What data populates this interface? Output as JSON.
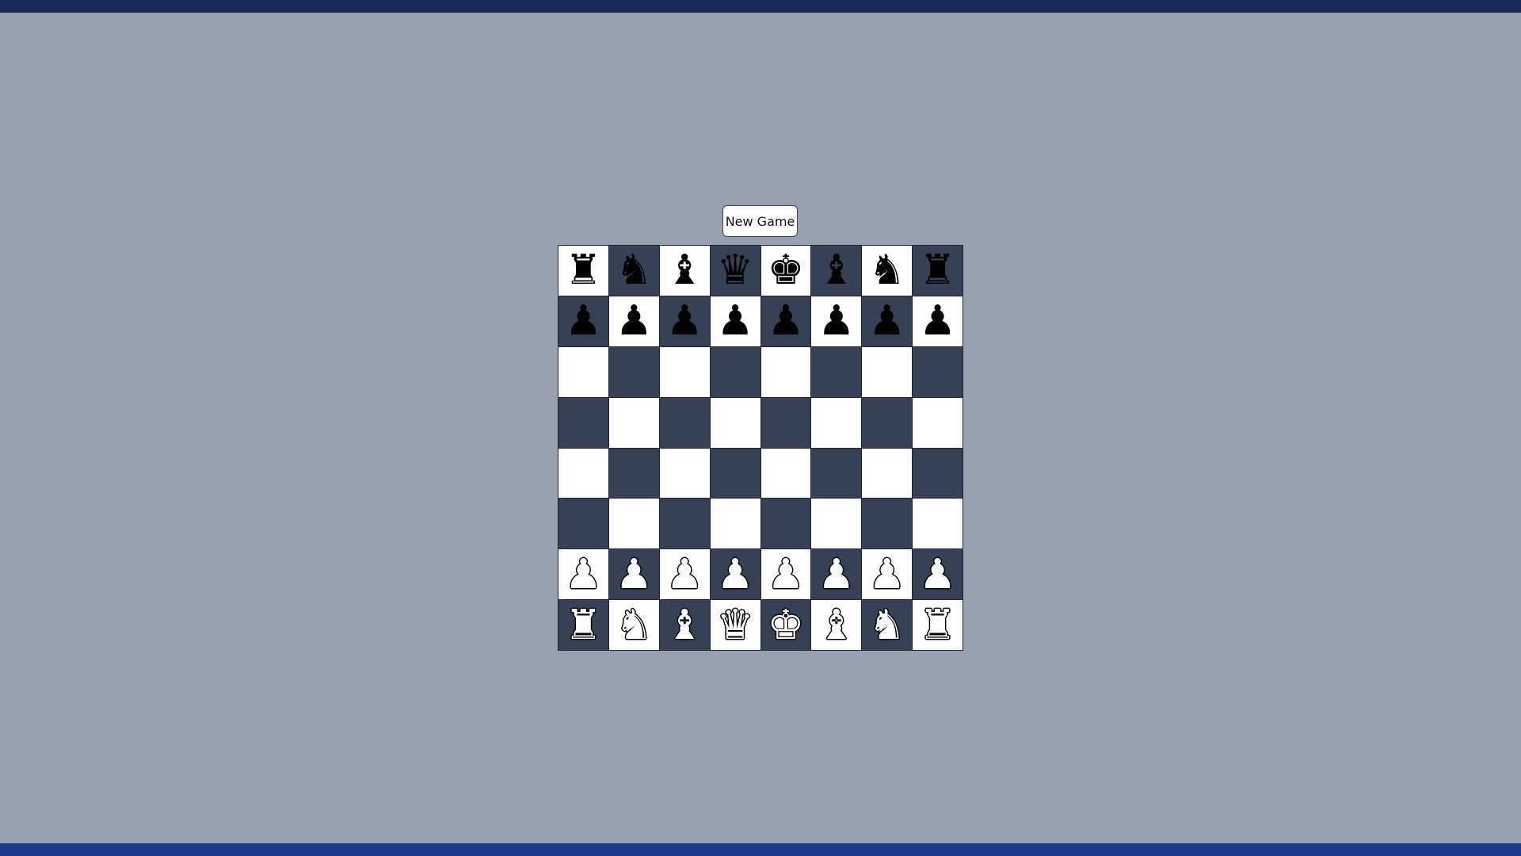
{
  "header": {
    "bar_color": "#1b2759"
  },
  "footer": {
    "bar_color": "#1e3a8a"
  },
  "controls": {
    "new_game_label": "New Game"
  },
  "colors": {
    "background": "#9aa1ae",
    "light_square": "#ffffff",
    "dark_square": "#364153"
  },
  "board": {
    "rows": [
      [
        {
          "color": "light",
          "piece": "♜",
          "side": "black",
          "piece_name": "rook"
        },
        {
          "color": "dark",
          "piece": "♞",
          "side": "black",
          "piece_name": "knight"
        },
        {
          "color": "light",
          "piece": "♝",
          "side": "black",
          "piece_name": "bishop"
        },
        {
          "color": "dark",
          "piece": "♛",
          "side": "black",
          "piece_name": "queen"
        },
        {
          "color": "light",
          "piece": "♚",
          "side": "black",
          "piece_name": "king"
        },
        {
          "color": "dark",
          "piece": "♝",
          "side": "black",
          "piece_name": "bishop"
        },
        {
          "color": "light",
          "piece": "♞",
          "side": "black",
          "piece_name": "knight"
        },
        {
          "color": "dark",
          "piece": "♜",
          "side": "black",
          "piece_name": "rook"
        }
      ],
      [
        {
          "color": "dark",
          "piece": "♟",
          "side": "black",
          "piece_name": "pawn"
        },
        {
          "color": "light",
          "piece": "♟",
          "side": "black",
          "piece_name": "pawn"
        },
        {
          "color": "dark",
          "piece": "♟",
          "side": "black",
          "piece_name": "pawn"
        },
        {
          "color": "light",
          "piece": "♟",
          "side": "black",
          "piece_name": "pawn"
        },
        {
          "color": "dark",
          "piece": "♟",
          "side": "black",
          "piece_name": "pawn"
        },
        {
          "color": "light",
          "piece": "♟",
          "side": "black",
          "piece_name": "pawn"
        },
        {
          "color": "dark",
          "piece": "♟",
          "side": "black",
          "piece_name": "pawn"
        },
        {
          "color": "light",
          "piece": "♟",
          "side": "black",
          "piece_name": "pawn"
        }
      ],
      [
        {
          "color": "light"
        },
        {
          "color": "dark"
        },
        {
          "color": "light"
        },
        {
          "color": "dark"
        },
        {
          "color": "light"
        },
        {
          "color": "dark"
        },
        {
          "color": "light"
        },
        {
          "color": "dark"
        }
      ],
      [
        {
          "color": "dark"
        },
        {
          "color": "light"
        },
        {
          "color": "dark"
        },
        {
          "color": "light"
        },
        {
          "color": "dark"
        },
        {
          "color": "light"
        },
        {
          "color": "dark"
        },
        {
          "color": "light"
        }
      ],
      [
        {
          "color": "light"
        },
        {
          "color": "dark"
        },
        {
          "color": "light"
        },
        {
          "color": "dark"
        },
        {
          "color": "light"
        },
        {
          "color": "dark"
        },
        {
          "color": "light"
        },
        {
          "color": "dark"
        }
      ],
      [
        {
          "color": "dark"
        },
        {
          "color": "light"
        },
        {
          "color": "dark"
        },
        {
          "color": "light"
        },
        {
          "color": "dark"
        },
        {
          "color": "light"
        },
        {
          "color": "dark"
        },
        {
          "color": "light"
        }
      ],
      [
        {
          "color": "light",
          "piece": "♟",
          "side": "white",
          "piece_name": "pawn"
        },
        {
          "color": "dark",
          "piece": "♟",
          "side": "white",
          "piece_name": "pawn"
        },
        {
          "color": "light",
          "piece": "♟",
          "side": "white",
          "piece_name": "pawn"
        },
        {
          "color": "dark",
          "piece": "♟",
          "side": "white",
          "piece_name": "pawn"
        },
        {
          "color": "light",
          "piece": "♟",
          "side": "white",
          "piece_name": "pawn"
        },
        {
          "color": "dark",
          "piece": "♟",
          "side": "white",
          "piece_name": "pawn"
        },
        {
          "color": "light",
          "piece": "♟",
          "side": "white",
          "piece_name": "pawn"
        },
        {
          "color": "dark",
          "piece": "♟",
          "side": "white",
          "piece_name": "pawn"
        }
      ],
      [
        {
          "color": "dark",
          "piece": "♜",
          "side": "white",
          "piece_name": "rook"
        },
        {
          "color": "light",
          "piece": "♞",
          "side": "white",
          "piece_name": "knight"
        },
        {
          "color": "dark",
          "piece": "♝",
          "side": "white",
          "piece_name": "bishop"
        },
        {
          "color": "light",
          "piece": "♛",
          "side": "white",
          "piece_name": "queen"
        },
        {
          "color": "dark",
          "piece": "♚",
          "side": "white",
          "piece_name": "king"
        },
        {
          "color": "light",
          "piece": "♝",
          "side": "white",
          "piece_name": "bishop"
        },
        {
          "color": "dark",
          "piece": "♞",
          "side": "white",
          "piece_name": "knight"
        },
        {
          "color": "light",
          "piece": "♜",
          "side": "white",
          "piece_name": "rook"
        }
      ]
    ]
  }
}
